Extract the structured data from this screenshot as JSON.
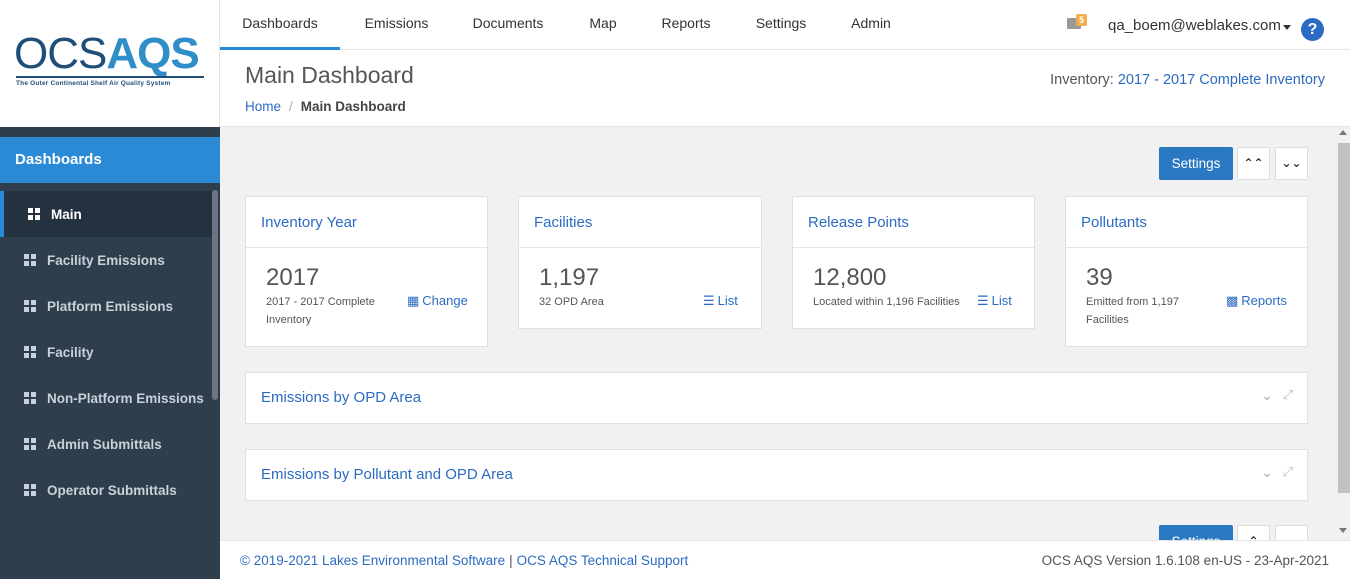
{
  "logo": {
    "ocs": "OCS",
    "aqs": "AQS",
    "tagline": "The Outer Continental Shelf Air Quality System"
  },
  "topnav": {
    "tabs": [
      "Dashboards",
      "Emissions",
      "Documents",
      "Map",
      "Reports",
      "Settings",
      "Admin"
    ],
    "active_tab": "Dashboards",
    "mail_count": "5",
    "user": "qa_boem@weblakes.com",
    "help": "?"
  },
  "sidebar": {
    "header": "Dashboards",
    "items": [
      "Main",
      "Facility Emissions",
      "Platform Emissions",
      "Facility",
      "Non-Platform Emissions",
      "Admin Submittals",
      "Operator Submittals"
    ],
    "active_item": "Main"
  },
  "header": {
    "title": "Main Dashboard",
    "breadcrumb_home": "Home",
    "breadcrumb_sep": "/",
    "breadcrumb_current": "Main Dashboard",
    "inventory_label": "Inventory:",
    "inventory_value": "2017 - 2017 Complete Inventory"
  },
  "main": {
    "settings_label": "Settings",
    "collapse_icon": "chevrons-up-icon",
    "expand_icon": "chevrons-down-icon",
    "cards": [
      {
        "title": "Inventory Year",
        "value": "2017",
        "subtitle": "2017 - 2017 Complete Inventory",
        "link": "Change",
        "link_icon": "calendar-icon"
      },
      {
        "title": "Facilities",
        "value": "1,197",
        "subtitle": "32 OPD Area",
        "link": "List",
        "link_icon": "list-icon"
      },
      {
        "title": "Release Points",
        "value": "12,800",
        "subtitle": "Located within 1,196 Facilities",
        "link": "List",
        "link_icon": "list-icon"
      },
      {
        "title": "Pollutants",
        "value": "39",
        "subtitle": "Emitted from 1,197 Facilities",
        "link": "Reports",
        "link_icon": "file-icon"
      }
    ],
    "panels": [
      "Emissions by OPD Area",
      "Emissions by Pollutant and OPD Area"
    ]
  },
  "footer": {
    "copyright": "© 2019-2021 Lakes Environmental Software",
    "sep": "|",
    "support": "OCS AQS Technical Support",
    "version": "OCS AQS Version 1.6.108 en-US - 23-Apr-2021"
  },
  "colors": {
    "accent": "#2b8ad6",
    "link": "#2b6bc2",
    "sidebar_bg": "#2f3e4d",
    "badge": "#f0ad4e"
  }
}
